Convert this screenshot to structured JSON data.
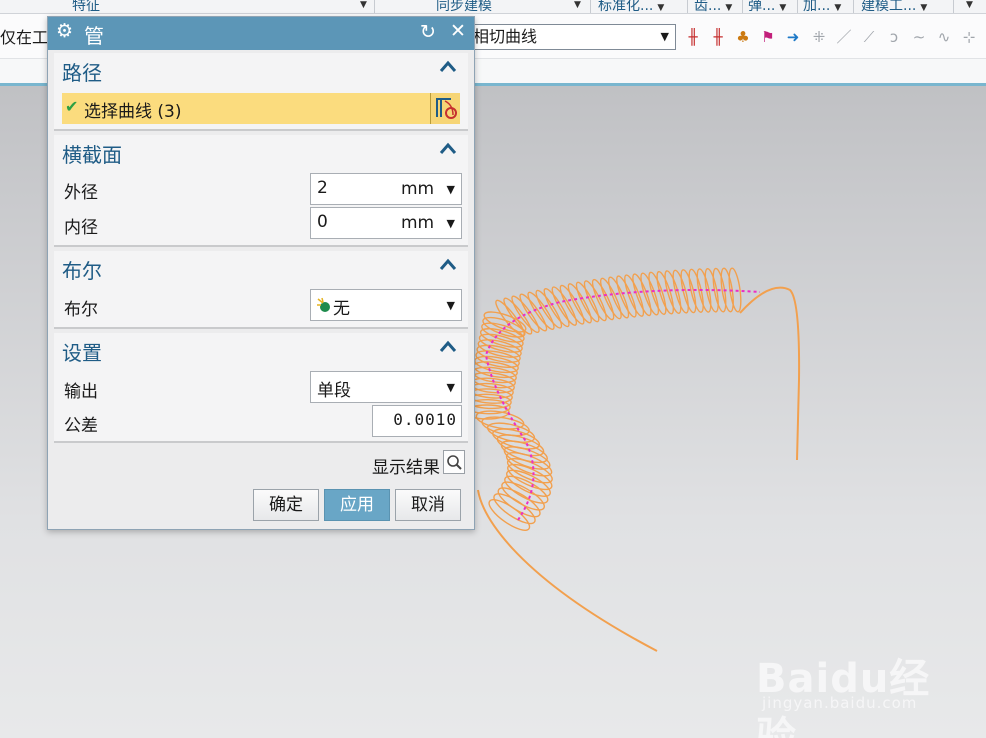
{
  "ribbon": {
    "groups": [
      {
        "label": "特征"
      },
      {
        "label": "同步建模"
      },
      {
        "label": "标准化..."
      },
      {
        "label": "齿..."
      },
      {
        "label": "弹..."
      },
      {
        "label": "加..."
      },
      {
        "label": "建模工..."
      }
    ]
  },
  "selection_bar": {
    "filter_label": "仅在工作",
    "curve_rule": "相切曲线"
  },
  "dialog": {
    "title": "管",
    "sections": {
      "path": {
        "heading": "路径",
        "select_label": "选择曲线 (3)"
      },
      "cross_section": {
        "heading": "横截面",
        "outer_label": "外径",
        "outer_value": "2",
        "outer_unit": "mm",
        "inner_label": "内径",
        "inner_value": "0",
        "inner_unit": "mm"
      },
      "boolean": {
        "heading": "布尔",
        "label": "布尔",
        "value": "无"
      },
      "settings": {
        "heading": "设置",
        "output_label": "输出",
        "output_value": "单段",
        "tolerance_label": "公差",
        "tolerance_value": "0.0010"
      }
    },
    "preview_label": "显示结果",
    "buttons": {
      "ok": "确定",
      "apply": "应用",
      "cancel": "取消"
    }
  },
  "colors": {
    "title_bar": "#5c96b7",
    "heading_text": "#1f5c86",
    "selected_row": "#fbdc7e",
    "spring": "#f2a04e",
    "path_curve": "#ec2ec4"
  },
  "watermark": {
    "brand": "Baidu经验",
    "url": "jingyan.baidu.com"
  }
}
